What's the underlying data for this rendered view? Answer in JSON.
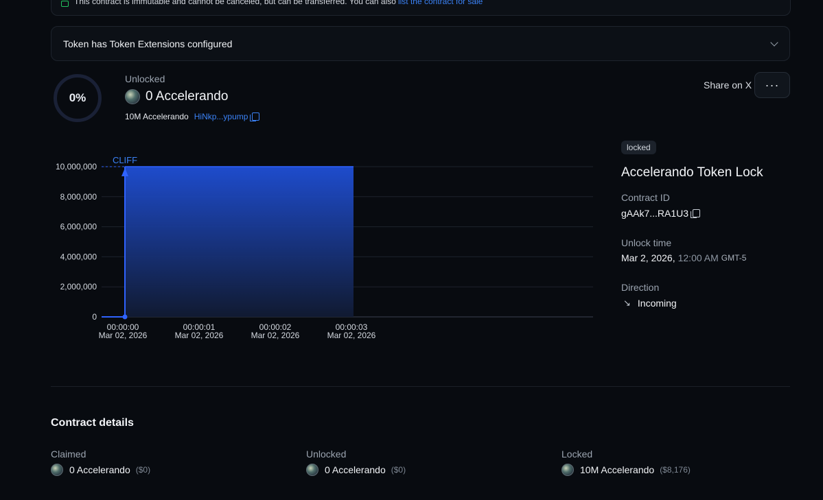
{
  "notice": {
    "text": "This contract is immutable and cannot be canceled, but can be transferred.  You can also",
    "link": "list the contract for sale"
  },
  "extensions_banner": "Token has Token Extensions configured",
  "progress": {
    "percent_label": "0%",
    "value": 0
  },
  "unlocked": {
    "label": "Unlocked",
    "amount": "0 Accelerando",
    "total": "10M Accelerando",
    "mint_address": "HiNkp...ypump"
  },
  "header_actions": {
    "share": "Share on X",
    "more": "···"
  },
  "lock_info": {
    "status_badge": "locked",
    "title": "Accelerando Token Lock",
    "contract_id_label": "Contract ID",
    "contract_id": "gAAk7...RA1U3",
    "unlock_time_label": "Unlock time",
    "unlock_date": "Mar 2, 2026,",
    "unlock_clock": "12:00 AM",
    "unlock_tz": "GMT-5",
    "direction_label": "Direction",
    "direction_icon": "arrow-down-right-icon",
    "direction": "Incoming"
  },
  "chart_data": {
    "type": "area",
    "annotation": "CLIFF",
    "x": [
      "00:00:00",
      "00:00:01",
      "00:00:02",
      "00:00:03"
    ],
    "x_sublabel": "Mar 02, 2026",
    "series": [
      {
        "values": [
          10000000,
          10000000,
          10000000,
          10000000
        ]
      }
    ],
    "start_point": 0,
    "yticks": [
      "0",
      "2,000,000",
      "4,000,000",
      "6,000,000",
      "8,000,000",
      "10,000,000"
    ],
    "ylim": [
      0,
      10000000
    ],
    "grid": true,
    "colors": {
      "fill_top": "#1f4fd6",
      "fill_bottom": "#0f1a33",
      "line": "#2f63ff"
    }
  },
  "details": {
    "title": "Contract details",
    "columns": [
      {
        "label": "Claimed",
        "value": "0 Accelerando",
        "usd": "($0)"
      },
      {
        "label": "Unlocked",
        "value": "0 Accelerando",
        "usd": "($0)"
      },
      {
        "label": "Locked",
        "value": "10M Accelerando",
        "usd": "($8,176)"
      }
    ]
  }
}
